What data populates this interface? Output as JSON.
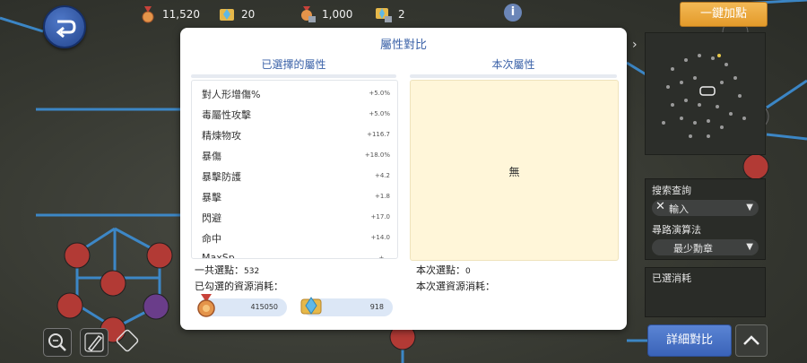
{
  "topbar": {
    "resources": [
      {
        "icon": "medal-icon",
        "value": "11,520"
      },
      {
        "icon": "crystal-box-icon",
        "value": "20"
      },
      {
        "icon": "locked-medal-icon",
        "value": "1,000"
      },
      {
        "icon": "locked-crystal-icon",
        "value": "2"
      }
    ],
    "info_label": "i",
    "auto_add_label": "一鍵加點"
  },
  "modal": {
    "title": "屬性對比",
    "selected_title": "已選擇的屬性",
    "current_title": "本次屬性",
    "attributes": [
      {
        "name": "對人形增傷%",
        "value": "+5.0%"
      },
      {
        "name": "毒屬性攻擊",
        "value": "+5.0%"
      },
      {
        "name": "精煉物攻",
        "value": "+116.7"
      },
      {
        "name": "暴傷",
        "value": "+18.0%"
      },
      {
        "name": "暴擊防護",
        "value": "+4.2"
      },
      {
        "name": "暴擊",
        "value": "+1.8"
      },
      {
        "name": "閃避",
        "value": "+17.0"
      },
      {
        "name": "命中",
        "value": "+14.0"
      },
      {
        "name": "MaxSp",
        "value": "+..."
      }
    ],
    "current_empty": "無",
    "total_points_label": "一共選點：",
    "total_points_value": "532",
    "selected_cost_label": "已勾選的資源消耗：",
    "cost_medal": "415050",
    "cost_crystal": "918",
    "this_points_label": "本次選點：",
    "this_points_value": "0",
    "this_cost_label": "本次選資源消耗："
  },
  "right_panel": {
    "search_label": "搜索查詢",
    "search_placeholder": "輸入",
    "path_label": "尋路演算法",
    "path_value": "最少勳章",
    "spent_label": "已選消耗",
    "detail_button": "詳細對比"
  },
  "colors": {
    "accent_blue": "#3b62a8",
    "orange_button": "#e9a53a",
    "current_bg": "#fff6d9"
  }
}
